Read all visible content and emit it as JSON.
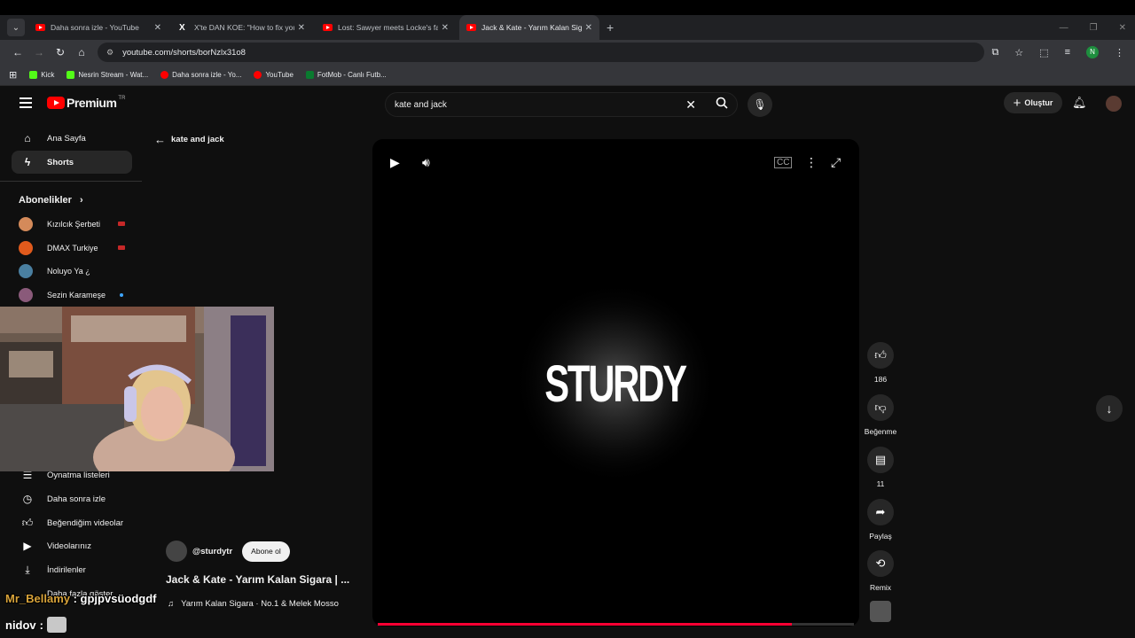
{
  "browser": {
    "tabs": [
      {
        "title": "Daha sonra izle - YouTube",
        "icon": "youtube-icon",
        "active": false
      },
      {
        "title": "X'te DAN KOE: \"How to fix your",
        "icon": "x-icon",
        "active": false
      },
      {
        "title": "Lost: Sawyer meets Locke's fath",
        "icon": "youtube-icon",
        "active": false
      },
      {
        "title": "Jack & Kate - Yarım Kalan Sigar",
        "icon": "youtube-icon",
        "active": true
      }
    ],
    "url": "youtube.com/shorts/borNzlx31o8",
    "profile_initial": "N",
    "bookmarks": [
      {
        "label": "Kick",
        "icon": "kick-icon"
      },
      {
        "label": "Nesrin Stream - Wat...",
        "icon": "kick-icon"
      },
      {
        "label": "Daha sonra izle - Yo...",
        "icon": "youtube-icon"
      },
      {
        "label": "YouTube",
        "icon": "youtube-icon"
      },
      {
        "label": "FotMob - Canlı Futb...",
        "icon": "fotmob-icon"
      }
    ]
  },
  "header": {
    "logo_text": "Premium",
    "logo_region": "TR",
    "search_value": "kate and jack",
    "create_label": "Oluştur"
  },
  "sidebar": {
    "top": [
      {
        "label": "Ana Sayfa",
        "icon": "home-icon"
      },
      {
        "label": "Shorts",
        "icon": "shorts-icon",
        "active": true
      }
    ],
    "subscriptions_title": "Abonelikler",
    "subscriptions": [
      {
        "label": "Kızılcık Şerbeti",
        "badge": "live",
        "color": "#d48a5a"
      },
      {
        "label": "DMAX Turkiye",
        "badge": "live",
        "color": "#e05a1c"
      },
      {
        "label": "Noluyo Ya ¿",
        "badge": "",
        "color": "#4a7fa0"
      },
      {
        "label": "Sezin Karameşe",
        "badge": "new",
        "color": "#8a5a7a"
      }
    ],
    "library": [
      {
        "label": "Oynatma listeleri",
        "icon": "playlist-icon"
      },
      {
        "label": "Daha sonra izle",
        "icon": "clock-icon"
      },
      {
        "label": "Beğendiğim videolar",
        "icon": "thumbs-up-icon"
      },
      {
        "label": "Videolarınız",
        "icon": "video-icon"
      },
      {
        "label": "İndirilenler",
        "icon": "download-icon"
      },
      {
        "label": "Daha fazla göster",
        "icon": "chevron-down-icon"
      }
    ]
  },
  "shorts": {
    "back_title": "kate and jack",
    "channel": "@sturdytr",
    "subscribe_label": "Abone ol",
    "video_title": "Jack & Kate - Yarım Kalan Sigara | ...",
    "music": "Yarım Kalan Sigara · No.1 & Melek Mosso",
    "overlay_text": "STURDY",
    "progress": 0.87,
    "actions": {
      "like_count": "186",
      "dislike_label": "Beğenme",
      "comment_count": "11",
      "share_label": "Paylaş",
      "remix_label": "Remix"
    }
  },
  "chat": [
    {
      "user": "Mr_Bellamy",
      "message": "gpjpvsüodgdf"
    },
    {
      "user": "nidov",
      "message": ""
    }
  ]
}
